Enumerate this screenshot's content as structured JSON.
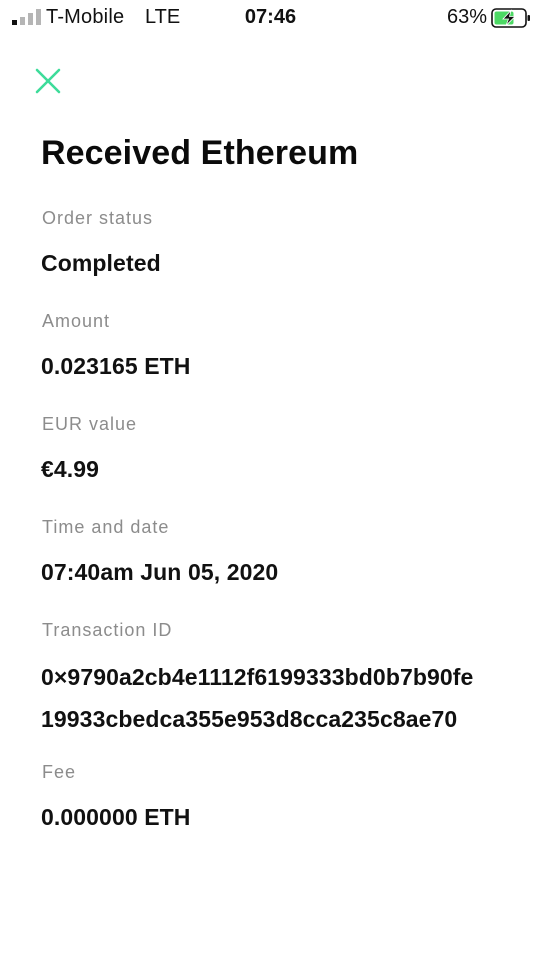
{
  "status_bar": {
    "carrier": "T-Mobile",
    "network": "LTE",
    "time": "07:46",
    "battery_percent": "63%",
    "battery_level": 0.63,
    "signal_bars_active": 1,
    "signal_bars_total": 4
  },
  "header": {
    "close_icon": "close-x-icon",
    "title": "Received Ethereum"
  },
  "colors": {
    "accent": "#3ddc9a",
    "label": "#8c8c8c",
    "value": "#111111",
    "battery_charging": "#4cd964"
  },
  "details": {
    "order_status": {
      "label": "Order status",
      "value": "Completed"
    },
    "amount": {
      "label": "Amount",
      "value": "0.023165 ETH"
    },
    "eur_value": {
      "label": "EUR value",
      "value": "€4.99"
    },
    "time_date": {
      "label": "Time and date",
      "value": "07:40am Jun 05, 2020"
    },
    "transaction_id": {
      "label": "Transaction ID",
      "line1": "0×9790a2cb4e1112f6199333bd0b7b90fe",
      "line2": "19933cbedca355e953d8cca235c8ae70"
    },
    "fee": {
      "label": "Fee",
      "value": "0.000000 ETH"
    }
  }
}
